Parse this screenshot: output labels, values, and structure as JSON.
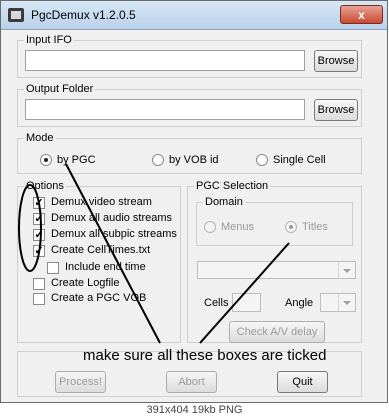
{
  "window": {
    "title": "PgcDemux v1.2.0.5",
    "close_label": "x"
  },
  "input_ifo": {
    "legend": "Input IFO",
    "value": "",
    "browse_label": "Browse"
  },
  "output_folder": {
    "legend": "Output Folder",
    "value": "",
    "browse_label": "Browse"
  },
  "mode": {
    "legend": "Mode",
    "options": [
      {
        "label": "by PGC",
        "selected": true
      },
      {
        "label": "by VOB id",
        "selected": false
      },
      {
        "label": "Single Cell",
        "selected": false
      }
    ]
  },
  "options": {
    "legend": "Options",
    "items": [
      {
        "label": "Demux video stream",
        "checked": true
      },
      {
        "label": "Demux all audio streams",
        "checked": true
      },
      {
        "label": "Demux all subpic streams",
        "checked": true
      },
      {
        "label": "Create CellTimes.txt",
        "checked": true
      },
      {
        "label": "Include end time",
        "checked": false
      },
      {
        "label": "Create Logfile",
        "checked": false
      },
      {
        "label": "Create a PGC VOB",
        "checked": false
      }
    ]
  },
  "pgc_selection": {
    "legend": "PGC Selection",
    "domain": {
      "legend": "Domain",
      "menus_label": "Menus",
      "titles_label": "Titles",
      "selected": "Titles"
    },
    "pgc_combo_value": "",
    "cells_label": "Cells",
    "cells_value": "",
    "angle_label": "Angle",
    "angle_value": "",
    "check_av_delay_label": "Check A/V delay"
  },
  "buttons": {
    "process_label": "Process!",
    "abort_label": "Abort",
    "quit_label": "Quit"
  },
  "annotation": {
    "text": "make sure all these boxes are ticked"
  },
  "status_bar": {
    "text": "391x404 19kb PNG"
  }
}
